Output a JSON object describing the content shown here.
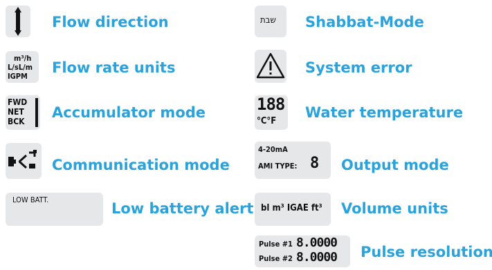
{
  "legend": {
    "flow_direction": {
      "label": "Flow direction"
    },
    "flow_rate_units": {
      "label": "Flow rate units",
      "icon_lines": [
        "m³/h",
        "L/sL/m",
        "IGPM"
      ]
    },
    "accumulator_mode": {
      "label": "Accumulator mode",
      "icon_lines": [
        "FWD",
        "NET",
        "BCK"
      ]
    },
    "communication_mode": {
      "label": "Communication mode"
    },
    "low_battery": {
      "label": "Low battery alert",
      "icon_text": "LOW BATT."
    },
    "shabbat_mode": {
      "label": "Shabbat-Mode",
      "icon_text": "שבת"
    },
    "system_error": {
      "label": "System error"
    },
    "water_temperature": {
      "label": "Water temperature",
      "digits": "188",
      "units": "°C°F"
    },
    "output_mode": {
      "label": "Output mode",
      "line1": "4-20mA",
      "line2": "AMI TYPE:",
      "digit": "8"
    },
    "volume_units": {
      "label": "Volume units",
      "icon_text": "bl m³ IGAE ft³"
    },
    "pulse_resolution": {
      "label": "Pulse resolution",
      "rows": [
        {
          "name": "Pulse #1",
          "value": "8.0000"
        },
        {
          "name": "Pulse #2",
          "value": "8.0000"
        }
      ]
    }
  },
  "colors": {
    "accent": "#2aa3dd",
    "icon_bg": "#e6e7e9"
  }
}
